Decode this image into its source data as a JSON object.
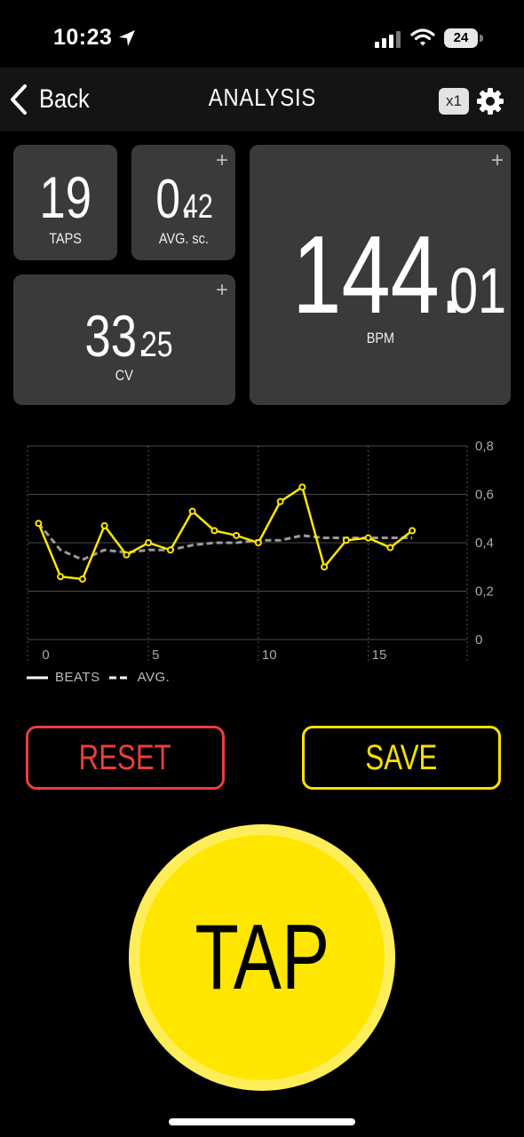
{
  "status_bar": {
    "time": "10:23",
    "battery": "24"
  },
  "nav": {
    "back_label": "Back",
    "title": "ANALYSIS",
    "multiplier": "x1"
  },
  "stats": {
    "taps": {
      "value": "19",
      "label": "TAPS"
    },
    "avg": {
      "int": "0.",
      "dec": "42",
      "label": "AVG. sc."
    },
    "bpm": {
      "int": "144.",
      "dec": "01",
      "label": "BPM"
    },
    "cv": {
      "int": "33.",
      "dec": "25",
      "label": "CV"
    }
  },
  "colors": {
    "accent": "#ffe600",
    "danger": "#ee3d3d",
    "card": "#3a3a3a",
    "avg_line": "#9a9a9a"
  },
  "chart_data": {
    "type": "line",
    "x": [
      0,
      1,
      2,
      3,
      4,
      5,
      6,
      7,
      8,
      9,
      10,
      11,
      12,
      13,
      14,
      15,
      16,
      17
    ],
    "series": [
      {
        "name": "BEATS",
        "values": [
          0.48,
          0.26,
          0.25,
          0.47,
          0.35,
          0.4,
          0.37,
          0.53,
          0.45,
          0.43,
          0.4,
          0.57,
          0.63,
          0.3,
          0.41,
          0.42,
          0.38,
          0.45
        ]
      },
      {
        "name": "AVG.",
        "values": [
          0.48,
          0.37,
          0.33,
          0.37,
          0.36,
          0.37,
          0.37,
          0.39,
          0.4,
          0.4,
          0.41,
          0.41,
          0.43,
          0.42,
          0.42,
          0.42,
          0.42,
          0.42
        ]
      }
    ],
    "x_ticks": [
      0,
      5,
      10,
      15
    ],
    "x_tick_labels": [
      "0",
      "5",
      "10",
      "15"
    ],
    "y_ticks": [
      0,
      0.2,
      0.4,
      0.6,
      0.8
    ],
    "y_tick_labels": [
      "0",
      "0,2",
      "0,4",
      "0,6",
      "0,8"
    ],
    "xlim": [
      -0.5,
      19.5
    ],
    "ylim": [
      0,
      0.8
    ],
    "grid": true,
    "legend_position": "bottom-left"
  },
  "legend": {
    "beats": "BEATS",
    "avg": "AVG."
  },
  "actions": {
    "reset": "RESET",
    "save": "SAVE",
    "tap": "TAP"
  },
  "plus_symbol": "+"
}
